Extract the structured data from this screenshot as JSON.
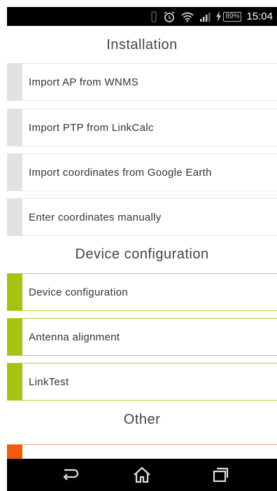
{
  "status_bar": {
    "battery": "89%",
    "time": "15:04",
    "icons": [
      "vibrate-icon",
      "alarm-icon",
      "wifi-icon",
      "signal-icon",
      "charging-icon"
    ]
  },
  "sections": {
    "installation": {
      "title": "Installation",
      "items": [
        {
          "label": "Import AP from WNMS"
        },
        {
          "label": "Import PTP from LinkCalc"
        },
        {
          "label": "Import coordinates from Google Earth"
        },
        {
          "label": "Enter coordinates manually"
        }
      ]
    },
    "device_configuration": {
      "title": "Device configuration",
      "items": [
        {
          "label": "Device configuration"
        },
        {
          "label": "Antenna alignment"
        },
        {
          "label": "LinkTest"
        }
      ]
    },
    "other": {
      "title": "Other",
      "items": [
        {
          "label": ""
        }
      ]
    }
  },
  "colors": {
    "installation_accent": "#e2e2e2",
    "device_accent": "#a6c314",
    "other_accent": "#f25a0f"
  },
  "nav_bar": {
    "icons": [
      "back-icon",
      "home-icon",
      "recent-apps-icon"
    ]
  }
}
